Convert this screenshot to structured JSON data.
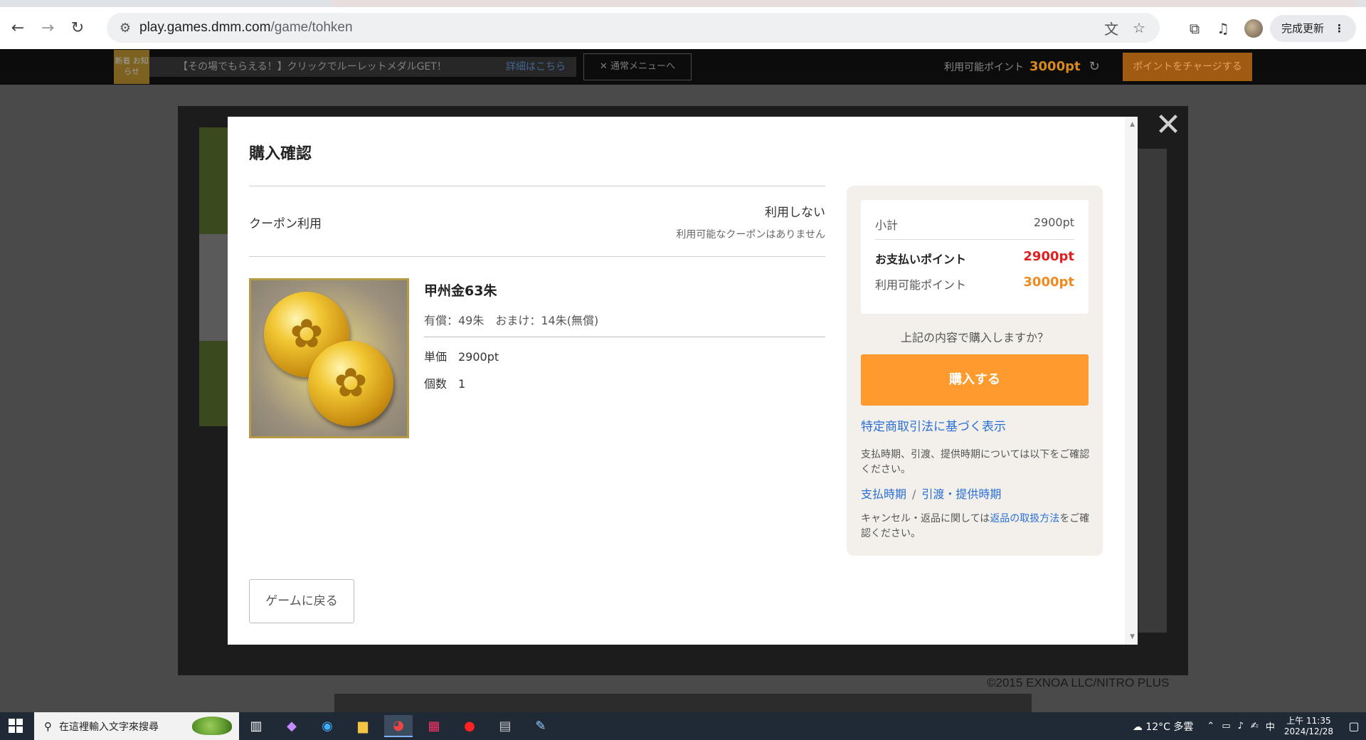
{
  "browser": {
    "url_host": "play.games.dmm.com",
    "url_path": "/game/tohken",
    "update_label": "完成更新",
    "icons": {
      "back": "←",
      "forward": "→",
      "reload": "↻",
      "site_info": "⚙",
      "translate": "文",
      "bookmark": "☆",
      "extensions": "⧉",
      "media": "♫",
      "menu": "⋮"
    }
  },
  "dmm_bar": {
    "new_badge": "新着\nお知らせ",
    "news_text": "【その場でもらえる！】クリックでルーレットメダルGET！",
    "news_more": "詳細はこちら",
    "menu_button": "✕ 通常メニューへ",
    "points_label": "利用可能ポイント",
    "points_value": "3000pt",
    "charge_button": "ポイントをチャージする"
  },
  "page": {
    "copyright": "©2015 EXNOA LLC/NITRO PLUS",
    "close_glyph": "✕"
  },
  "modal": {
    "title": "購入確認",
    "coupon": {
      "label": "クーポン利用",
      "value": "利用しない",
      "note": "利用可能なクーポンはありません"
    },
    "product": {
      "name": "甲州金63朱",
      "paid": "有償：49朱",
      "bonus": "おまけ：14朱(無償)",
      "unit_price_label": "単価",
      "unit_price_value": "2900pt",
      "quantity_label": "個数",
      "quantity_value": "1"
    },
    "summary": {
      "subtotal_label": "小計",
      "subtotal_value": "2900pt",
      "pay_label": "お支払いポイント",
      "pay_value": "2900pt",
      "available_label": "利用可能ポイント",
      "available_value": "3000pt"
    },
    "confirm_question": "上記の内容で購入しますか？",
    "buy_button": "購入する",
    "law_link": "特定商取引法に基づく表示",
    "timing_note": "支払時期、引渡、提供時期については以下をご確認ください。",
    "link_payment": "支払時期",
    "link_sep": "/",
    "link_delivery": "引渡・提供時期",
    "cancel_note_before": "キャンセル・返品に関しては",
    "cancel_note_link": "返品の取扱方法",
    "cancel_note_after": "をご確認ください。",
    "back_button": "ゲームに戻る"
  },
  "taskbar": {
    "search_placeholder": "在這裡輸入文字來搜尋",
    "weather": "12°C 多雲",
    "ime": "中",
    "time": "上午 11:35",
    "date": "2024/12/28"
  }
}
